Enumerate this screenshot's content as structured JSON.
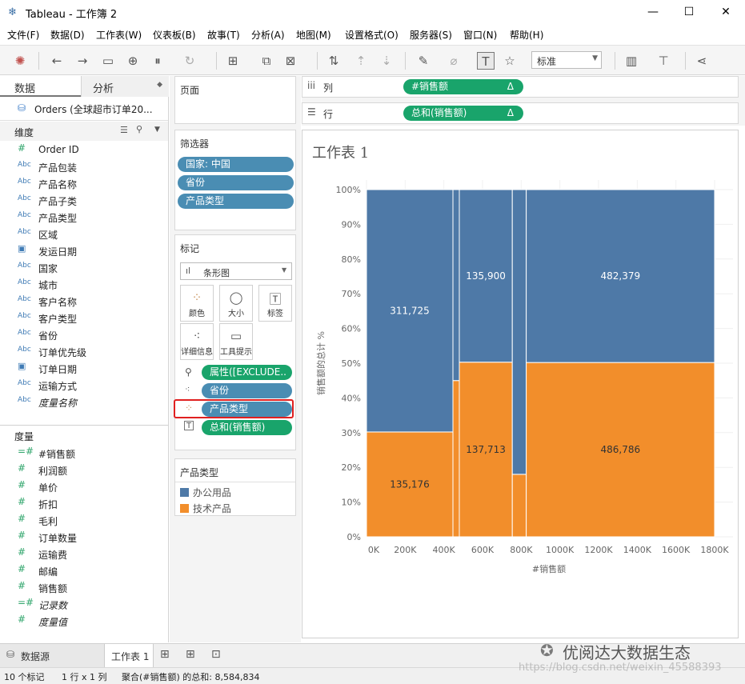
{
  "window": {
    "title": "Tableau - 工作簿 2"
  },
  "menu": [
    "文件(F)",
    "数据(D)",
    "工作表(W)",
    "仪表板(B)",
    "故事(T)",
    "分析(A)",
    "地图(M)",
    "设置格式(O)",
    "服务器(S)",
    "窗口(N)",
    "帮助(H)"
  ],
  "toolbar": {
    "fit_select": "标准"
  },
  "data_pane": {
    "tab_data": "数据",
    "tab_analysis": "分析",
    "datasource": "Orders (全球超市订单20...",
    "dimensions_header": "维度",
    "dimensions": [
      {
        "icon": "#",
        "name": "Order ID",
        "italic": false
      },
      {
        "icon": "Abc",
        "name": "产品包装",
        "italic": false
      },
      {
        "icon": "Abc",
        "name": "产品名称",
        "italic": false
      },
      {
        "icon": "Abc",
        "name": "产品子类",
        "italic": false
      },
      {
        "icon": "Abc",
        "name": "产品类型",
        "italic": false
      },
      {
        "icon": "Abc",
        "name": "区域",
        "italic": false
      },
      {
        "icon": "cal",
        "name": "发运日期",
        "italic": false
      },
      {
        "icon": "Abc",
        "name": "国家",
        "italic": false
      },
      {
        "icon": "Abc",
        "name": "城市",
        "italic": false
      },
      {
        "icon": "Abc",
        "name": "客户名称",
        "italic": false
      },
      {
        "icon": "Abc",
        "name": "客户类型",
        "italic": false
      },
      {
        "icon": "Abc",
        "name": "省份",
        "italic": false
      },
      {
        "icon": "Abc",
        "name": "订单优先级",
        "italic": false
      },
      {
        "icon": "cal",
        "name": "订单日期",
        "italic": false
      },
      {
        "icon": "Abc",
        "name": "运输方式",
        "italic": false
      },
      {
        "icon": "Abc",
        "name": "度量名称",
        "italic": true
      }
    ],
    "measures_header": "度量",
    "measures": [
      {
        "icon": "=#",
        "name": "#销售额",
        "italic": false
      },
      {
        "icon": "#",
        "name": "利润额",
        "italic": false
      },
      {
        "icon": "#",
        "name": "单价",
        "italic": false
      },
      {
        "icon": "#",
        "name": "折扣",
        "italic": false
      },
      {
        "icon": "#",
        "name": "毛利",
        "italic": false
      },
      {
        "icon": "#",
        "name": "订单数量",
        "italic": false
      },
      {
        "icon": "#",
        "name": "运输费",
        "italic": false
      },
      {
        "icon": "#",
        "name": "邮编",
        "italic": false
      },
      {
        "icon": "#",
        "name": "销售额",
        "italic": false
      },
      {
        "icon": "=#",
        "name": "记录数",
        "italic": true
      },
      {
        "icon": "#",
        "name": "度量值",
        "italic": true
      }
    ]
  },
  "pages_card": {
    "title": "页面"
  },
  "filters_card": {
    "title": "筛选器",
    "pills": [
      "国家: 中国",
      "省份",
      "产品类型"
    ]
  },
  "marks_card": {
    "title": "标记",
    "type": "条形图",
    "buttons": [
      "颜色",
      "大小",
      "标签",
      "详细信息",
      "工具提示"
    ],
    "pills": [
      "属性([EXCLUDE..",
      "省份",
      "产品类型",
      "总和(销售额)"
    ]
  },
  "legend": {
    "title": "产品类型",
    "items": [
      {
        "label": "办公用品",
        "color": "#4e79a7"
      },
      {
        "label": "技术产品",
        "color": "#f28e2b"
      }
    ]
  },
  "shelves": {
    "columns_label": "列",
    "columns_pill": "#销售额",
    "rows_label": "行",
    "rows_pill": "总和(销售额)",
    "delta": "Δ"
  },
  "chart_data": {
    "type": "bar",
    "subtype": "marimekko",
    "title": "工作表 1",
    "xlabel": "#销售额",
    "ylabel": "销售额的总计 %",
    "x_ticks": [
      "0K",
      "200K",
      "400K",
      "600K",
      "800K",
      "1000K",
      "1200K",
      "1400K",
      "1600K",
      "1800K"
    ],
    "y_ticks": [
      "0%",
      "10%",
      "20%",
      "30%",
      "40%",
      "50%",
      "60%",
      "70%",
      "80%",
      "90%",
      "100%"
    ],
    "xlim": [
      0,
      1800000
    ],
    "ylim": [
      0,
      100
    ],
    "series": [
      {
        "name": "办公用品",
        "color": "#4e79a7"
      },
      {
        "name": "技术产品",
        "color": "#f28e2b"
      }
    ],
    "columns": [
      {
        "x0": 0,
        "x1": 447000,
        "split": 30.2,
        "labels": {
          "top": "311,725",
          "bottom": "135,176"
        }
      },
      {
        "x0": 447000,
        "x1": 480000,
        "split": 45,
        "labels": {}
      },
      {
        "x0": 480000,
        "x1": 754000,
        "split": 50.3,
        "labels": {
          "top": "135,900",
          "bottom": "137,713"
        }
      },
      {
        "x0": 754000,
        "x1": 826000,
        "split": 18,
        "labels": {}
      },
      {
        "x0": 826000,
        "x1": 1800000,
        "split": 50.2,
        "labels": {
          "top": "482,379",
          "bottom": "486,786"
        }
      }
    ]
  },
  "sheet_tabs": {
    "datasource": "数据源",
    "active": "工作表 1"
  },
  "status": {
    "marks": "10 个标记",
    "rows_cols": "1 行 x 1 列",
    "sum": "聚合(#销售额) 的总和: 8,584,834"
  },
  "watermark": {
    "brand": "优阅达大数据生态",
    "url": "https://blog.csdn.net/weixin_45588393"
  }
}
